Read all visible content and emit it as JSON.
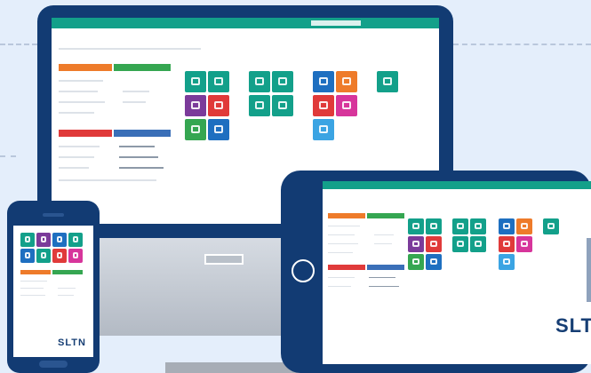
{
  "colors": {
    "bg": "#e4eefb",
    "frame": "#123b73",
    "teal": "#13a08a",
    "green": "#35a651",
    "orange": "#ee7b2a",
    "blue": "#1e6fc0",
    "red": "#e03a3a",
    "purple": "#7b3b9a",
    "pink": "#d7359b",
    "lightblue": "#3ba4e3",
    "hdr_orange": "#ee7b2a",
    "hdr_green": "#35a651",
    "hdr_red": "#e03a3a",
    "hdr_blue": "#3a6fb8"
  },
  "app": {
    "title": "",
    "subtitle": "",
    "section_headers": [
      "",
      "",
      "",
      ""
    ]
  },
  "brand": {
    "name": "SLTN",
    "tagline": ""
  },
  "tiles": [
    {
      "icon": "doc-icon",
      "color": "#13a08a"
    },
    {
      "icon": "folder-icon",
      "color": "#13a08a"
    },
    {
      "icon": "doc-icon",
      "color": "#7b3b9a"
    },
    {
      "icon": "doc-icon",
      "color": "#e03a3a"
    },
    {
      "icon": "excel-icon",
      "color": "#35a651"
    },
    {
      "icon": "word-icon",
      "color": "#1e6fc0"
    },
    {
      "icon": "chat-icon",
      "color": "#13a08a"
    },
    {
      "icon": "doc-icon",
      "color": "#13a08a"
    },
    {
      "icon": "user-icon",
      "color": "#13a08a"
    },
    {
      "icon": "chart-icon",
      "color": "#13a08a"
    },
    {
      "icon": "chart-icon",
      "color": "#1e6fc0"
    },
    {
      "icon": "clock-icon",
      "color": "#ee7b2a"
    },
    {
      "icon": "mail-icon",
      "color": "#e03a3a"
    },
    {
      "icon": "link-icon",
      "color": "#d7359b"
    },
    {
      "icon": "globe-icon",
      "color": "#3ba4e3"
    },
    {
      "icon": "monitor-icon",
      "color": "#13a08a"
    }
  ]
}
